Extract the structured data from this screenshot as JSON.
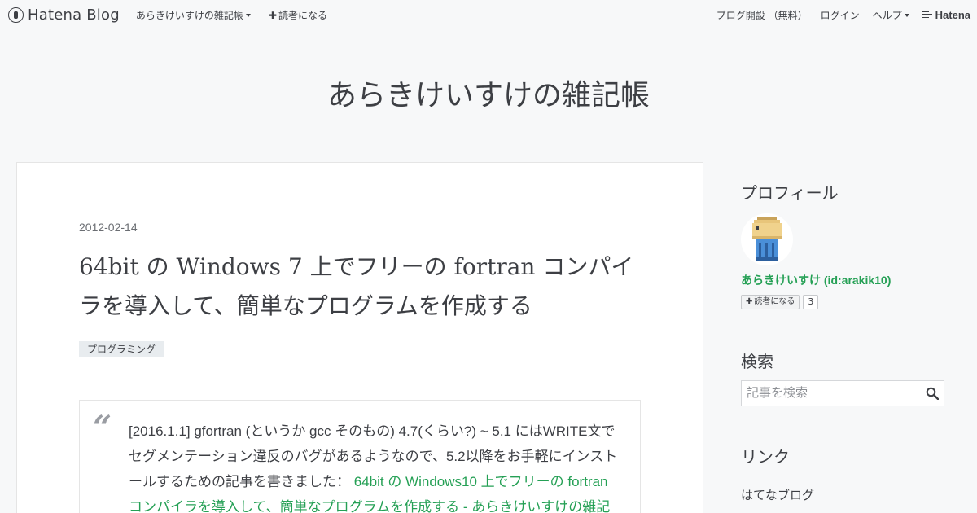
{
  "topbar": {
    "brand": "Hatena Blog",
    "blog_menu": "あらきけいすけの雑記帳",
    "subscribe": "読者になる",
    "open_blog": "ブログ開設 （無料）",
    "login": "ログイン",
    "help": "ヘルプ",
    "hatena": "Hatena"
  },
  "blog": {
    "title": "あらきけいすけの雑記帳"
  },
  "entry": {
    "date": "2012-02-14",
    "title": "64bit の Windows 7 上でフリーの fortran コンパイラを導入して、簡単なプログラムを作成する",
    "category": "プログラミング",
    "quote_mark": "“",
    "quote_text": "[2016.1.1] gfortran (というか gcc そのもの) 4.7(くらい?) ~ 5.1 にはWRITE文でセグメンテーション違反のバグがあるようなので、5.2以降をお手軽にインストールするための記事を書きました：",
    "quote_link": "64bit の Windows10 上でフリーの fortran コンパイラを導入して、簡単なプログラムを作成する - あらきけいすけの雑記"
  },
  "sidebar": {
    "profile_heading": "プロフィール",
    "profile_name": "あらきけいすけ (id:arakik10)",
    "subscribe_label": "読者になる",
    "subscriber_count": "3",
    "search_heading": "検索",
    "search_placeholder": "記事を検索",
    "links_heading": "リンク",
    "links": [
      "はてなブログ"
    ]
  },
  "icons": {
    "brand": "hatena-blog-logo-icon",
    "search": "search-icon",
    "caret": "caret-down-icon",
    "avatar": "pixel-avatar-icon"
  },
  "colors": {
    "background": "#f7f8f9",
    "text": "#3d3f44",
    "link": "#25a055",
    "card": "#ffffff"
  }
}
